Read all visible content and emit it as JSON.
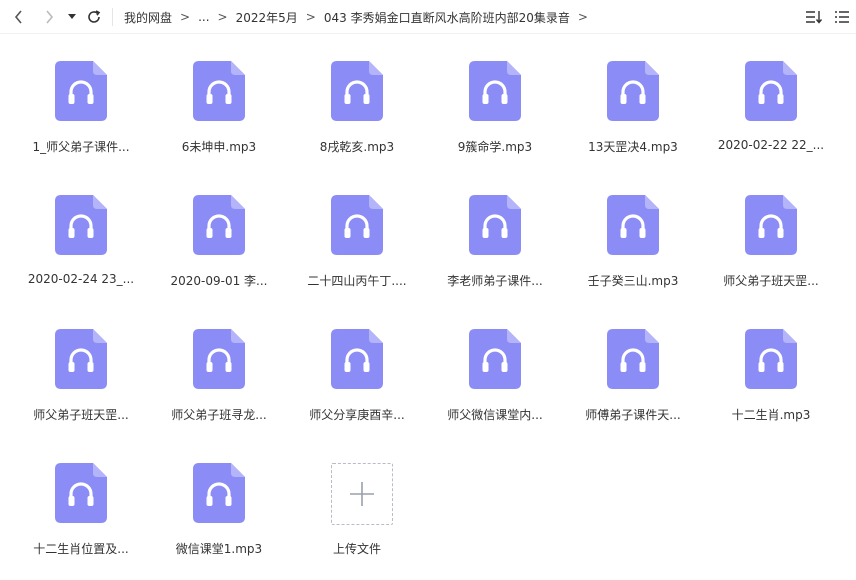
{
  "toolbar": {
    "back_icon": "chevron-left-icon",
    "forward_icon": "chevron-right-icon",
    "history_icon": "caret-down-icon",
    "refresh_icon": "refresh-icon",
    "sort_icon": "sort-icon",
    "list_view_icon": "list-view-icon"
  },
  "breadcrumb": {
    "items": [
      "我的网盘",
      "...",
      "2022年5月",
      "043 李秀娟金口直断风水高阶班内部20集录音"
    ],
    "separator": ">"
  },
  "files": [
    {
      "name": "1_师父弟子课件..."
    },
    {
      "name": "6未坤申.mp3"
    },
    {
      "name": "8戌乾亥.mp3"
    },
    {
      "name": "9簇命学.mp3"
    },
    {
      "name": "13天罡决4.mp3"
    },
    {
      "name": "2020-02-22 22_..."
    },
    {
      "name": "2020-02-24 23_..."
    },
    {
      "name": "2020-09-01 李..."
    },
    {
      "name": "二十四山丙午丁...."
    },
    {
      "name": "李老师弟子课件..."
    },
    {
      "name": "壬子癸三山.mp3"
    },
    {
      "name": "师父弟子班天罡..."
    },
    {
      "name": "师父弟子班天罡..."
    },
    {
      "name": "师父弟子班寻龙..."
    },
    {
      "name": "师父分享庚酉辛..."
    },
    {
      "name": "师父微信课堂内..."
    },
    {
      "name": "师傅弟子课件天..."
    },
    {
      "name": "十二生肖.mp3"
    },
    {
      "name": "十二生肖位置及..."
    },
    {
      "name": "微信课堂1.mp3"
    }
  ],
  "upload": {
    "label": "上传文件",
    "icon": "plus-icon"
  },
  "colors": {
    "file_icon": "#8b8cf5",
    "file_icon_fold": "#b3b4fa",
    "text": "#333333"
  }
}
